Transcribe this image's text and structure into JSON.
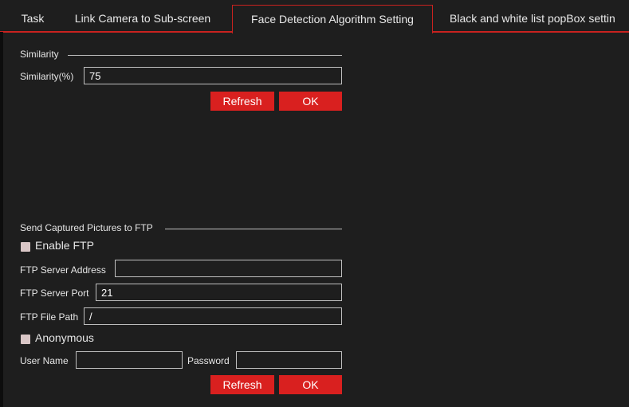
{
  "tabs": [
    {
      "label": "Task",
      "active": false
    },
    {
      "label": "Link Camera to Sub-screen",
      "active": false
    },
    {
      "label": "Face Detection Algorithm Setting",
      "active": true
    },
    {
      "label": "Black and white list popBox settin",
      "active": false
    }
  ],
  "similarity": {
    "section_title": "Similarity",
    "label": "Similarity(%)",
    "value": "75",
    "refresh_label": "Refresh",
    "ok_label": "OK"
  },
  "ftp": {
    "section_title": "Send Captured Pictures to FTP",
    "enable_label": "Enable FTP",
    "enable_checked": false,
    "server_address_label": "FTP Server Address",
    "server_address_value": "",
    "server_port_label": "FTP Server Port",
    "server_port_value": "21",
    "file_path_label": "FTP File Path",
    "file_path_value": "/",
    "anonymous_label": "Anonymous",
    "anonymous_checked": false,
    "username_label": "User Name",
    "username_value": "",
    "password_label": "Password",
    "password_value": "",
    "refresh_label": "Refresh",
    "ok_label": "OK"
  },
  "colors": {
    "accent": "#d9201f",
    "background": "#1e1e1e",
    "checkbox": "#d9c6c6"
  }
}
